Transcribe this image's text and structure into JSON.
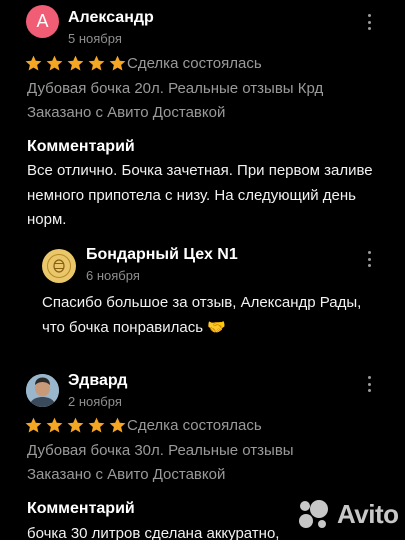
{
  "colors": {
    "star": "#f5a623",
    "avatar_bg": "#f25d76",
    "seller_logo": "#e9c76a",
    "muted_text": "#9a9a9a"
  },
  "reviews": [
    {
      "avatar_letter": "А",
      "author": "Александр",
      "date": "5 ноября",
      "rating": 5,
      "deal_status": "Сделка состоялась",
      "item": "Дубовая бочка 20л. Реальные отзывы Крд",
      "delivery": "Заказано с Авито Доставкой",
      "comment_heading": "Комментарий",
      "comment": "Все отлично. Бочка зачетная. При первом заливе немного припотела с низу. На следующий день норм.",
      "reply": {
        "seller_name": "Бондарный Цех N1",
        "date": "6 ноября",
        "text": "Спасибо большое за отзыв, Александр Рады, что бочка понравилась 🤝"
      }
    },
    {
      "avatar_icon": "user-photo",
      "author": "Эдвард",
      "date": "2 ноября",
      "rating": 5,
      "deal_status": "Сделка состоялась",
      "item": "Дубовая бочка 30л. Реальные отзывы",
      "delivery": "Заказано с Авито Доставкой",
      "comment_heading": "Комментарий",
      "comment": "бочка 30 литров сделана аккуратно,"
    }
  ],
  "watermark": {
    "text": "Avito",
    "icon": "avito-logo-icon"
  }
}
